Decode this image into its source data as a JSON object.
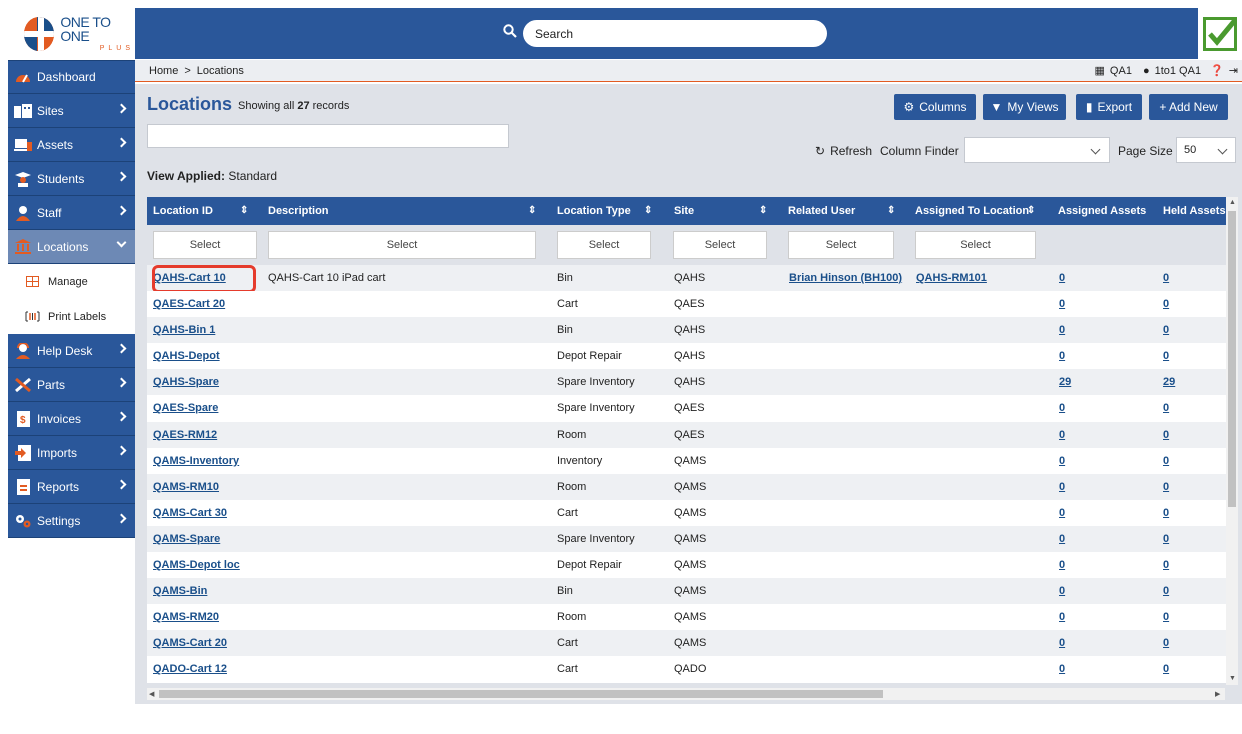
{
  "header": {
    "logo_line1": "ONE TO ONE",
    "logo_line2": "PLUS",
    "search_placeholder": "Search"
  },
  "breadcrumb": {
    "home": "Home",
    "sep": ">",
    "current": "Locations"
  },
  "user": {
    "site": "QA1",
    "name": "1to1 QA1"
  },
  "sidebar": {
    "items": [
      {
        "label": "Dashboard",
        "icon": "dashboard-icon"
      },
      {
        "label": "Sites",
        "icon": "sites-icon"
      },
      {
        "label": "Assets",
        "icon": "assets-icon"
      },
      {
        "label": "Students",
        "icon": "students-icon"
      },
      {
        "label": "Staff",
        "icon": "staff-icon"
      },
      {
        "label": "Locations",
        "icon": "locations-icon"
      },
      {
        "label": "Help Desk",
        "icon": "helpdesk-icon"
      },
      {
        "label": "Parts",
        "icon": "parts-icon"
      },
      {
        "label": "Invoices",
        "icon": "invoices-icon"
      },
      {
        "label": "Imports",
        "icon": "imports-icon"
      },
      {
        "label": "Reports",
        "icon": "reports-icon"
      },
      {
        "label": "Settings",
        "icon": "settings-icon"
      }
    ],
    "sub_items": [
      {
        "label": "Manage"
      },
      {
        "label": "Print Labels"
      }
    ]
  },
  "page": {
    "title": "Locations",
    "showing_prefix": "Showing all",
    "record_count": "27",
    "showing_suffix": "records",
    "view_applied_label": "View Applied:",
    "view_applied_value": "Standard"
  },
  "toolbar": {
    "columns": "Columns",
    "my_views": "My Views",
    "export": "Export",
    "add_new": "+ Add New",
    "refresh": "Refresh",
    "column_finder": "Column Finder",
    "page_size_label": "Page Size",
    "page_size_value": "50"
  },
  "table": {
    "headers": [
      "Location ID",
      "Description",
      "Location Type",
      "Site",
      "Related User",
      "Assigned To Location",
      "Assigned Assets",
      "Held Assets"
    ],
    "filter_placeholder": "Select",
    "rows": [
      {
        "id": "QAHS-Cart 10",
        "desc": "QAHS-Cart 10 iPad cart",
        "type": "Bin",
        "site": "QAHS",
        "user": "Brian Hinson (BH100)",
        "assigned_to": "QAHS-RM101",
        "assigned": "0",
        "held": "0"
      },
      {
        "id": "QAES-Cart 20",
        "desc": "",
        "type": "Cart",
        "site": "QAES",
        "user": "",
        "assigned_to": "",
        "assigned": "0",
        "held": "0"
      },
      {
        "id": "QAHS-Bin 1",
        "desc": "",
        "type": "Bin",
        "site": "QAHS",
        "user": "",
        "assigned_to": "",
        "assigned": "0",
        "held": "0"
      },
      {
        "id": "QAHS-Depot",
        "desc": "",
        "type": "Depot Repair",
        "site": "QAHS",
        "user": "",
        "assigned_to": "",
        "assigned": "0",
        "held": "0"
      },
      {
        "id": "QAHS-Spare",
        "desc": "",
        "type": "Spare Inventory",
        "site": "QAHS",
        "user": "",
        "assigned_to": "",
        "assigned": "29",
        "held": "29"
      },
      {
        "id": "QAES-Spare",
        "desc": "",
        "type": "Spare Inventory",
        "site": "QAES",
        "user": "",
        "assigned_to": "",
        "assigned": "0",
        "held": "0"
      },
      {
        "id": "QAES-RM12",
        "desc": "",
        "type": "Room",
        "site": "QAES",
        "user": "",
        "assigned_to": "",
        "assigned": "0",
        "held": "0"
      },
      {
        "id": "QAMS-Inventory",
        "desc": "",
        "type": "Inventory",
        "site": "QAMS",
        "user": "",
        "assigned_to": "",
        "assigned": "0",
        "held": "0"
      },
      {
        "id": "QAMS-RM10",
        "desc": "",
        "type": "Room",
        "site": "QAMS",
        "user": "",
        "assigned_to": "",
        "assigned": "0",
        "held": "0"
      },
      {
        "id": "QAMS-Cart 30",
        "desc": "",
        "type": "Cart",
        "site": "QAMS",
        "user": "",
        "assigned_to": "",
        "assigned": "0",
        "held": "0"
      },
      {
        "id": "QAMS-Spare",
        "desc": "",
        "type": "Spare Inventory",
        "site": "QAMS",
        "user": "",
        "assigned_to": "",
        "assigned": "0",
        "held": "0"
      },
      {
        "id": "QAMS-Depot loc",
        "desc": "",
        "type": "Depot Repair",
        "site": "QAMS",
        "user": "",
        "assigned_to": "",
        "assigned": "0",
        "held": "0"
      },
      {
        "id": "QAMS-Bin",
        "desc": "",
        "type": "Bin",
        "site": "QAMS",
        "user": "",
        "assigned_to": "",
        "assigned": "0",
        "held": "0"
      },
      {
        "id": "QAMS-RM20",
        "desc": "",
        "type": "Room",
        "site": "QAMS",
        "user": "",
        "assigned_to": "",
        "assigned": "0",
        "held": "0"
      },
      {
        "id": "QAMS-Cart 20",
        "desc": "",
        "type": "Cart",
        "site": "QAMS",
        "user": "",
        "assigned_to": "",
        "assigned": "0",
        "held": "0"
      },
      {
        "id": "QADO-Cart 12",
        "desc": "",
        "type": "Cart",
        "site": "QADO",
        "user": "",
        "assigned_to": "",
        "assigned": "0",
        "held": "0"
      }
    ]
  },
  "colors": {
    "brand_blue": "#2a579a",
    "brand_orange": "#e25b22",
    "highlight_red": "#e53b2c",
    "check_green": "#4a9a2f"
  }
}
